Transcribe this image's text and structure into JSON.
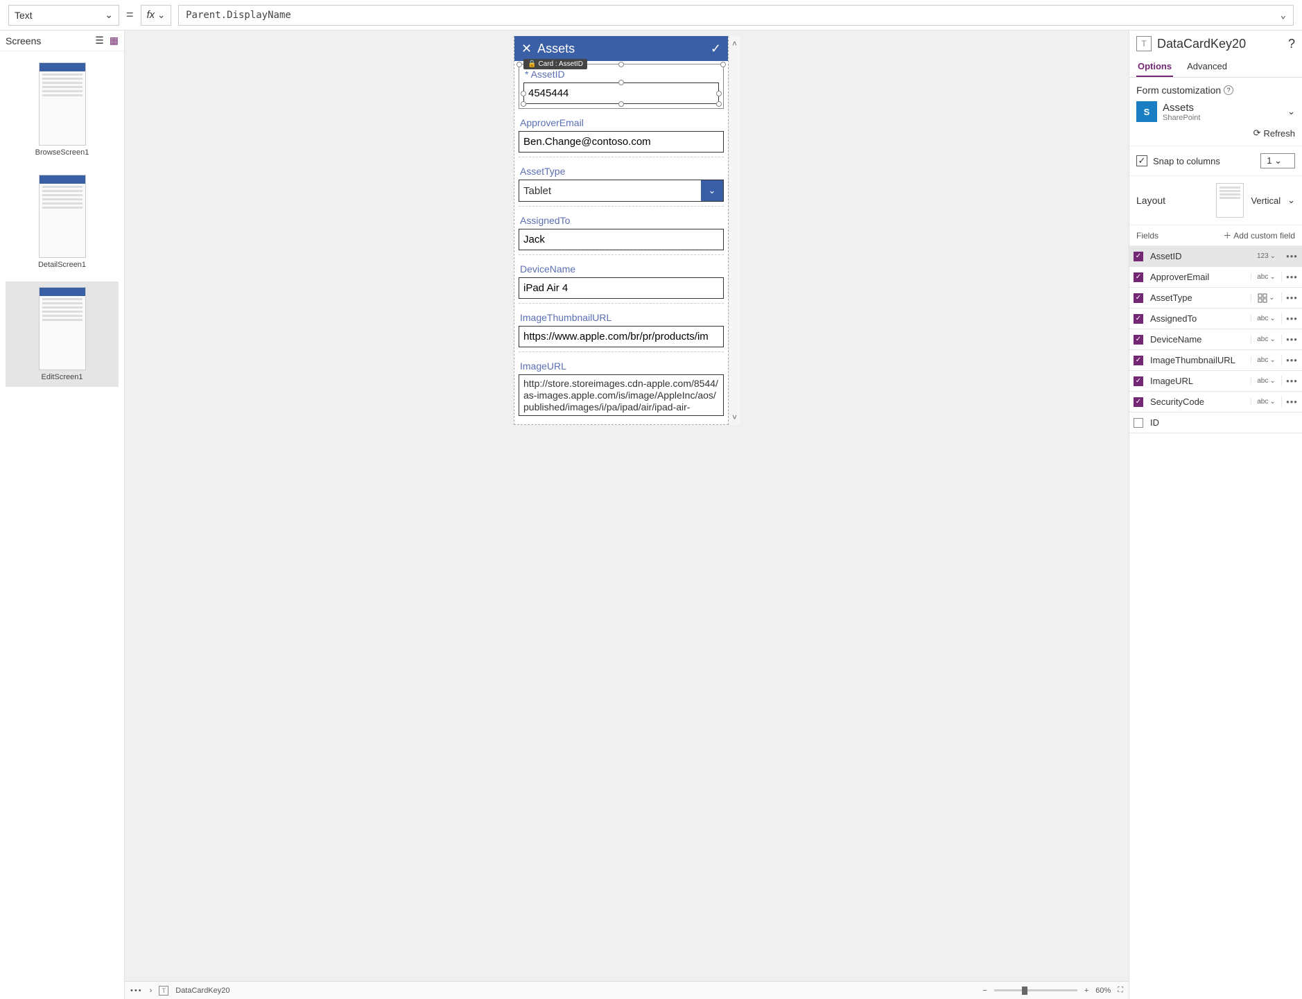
{
  "formulaBar": {
    "property": "Text",
    "fxLabel": "fx",
    "formula": "Parent.DisplayName"
  },
  "leftPane": {
    "title": "Screens"
  },
  "screens": [
    {
      "name": "BrowseScreen1"
    },
    {
      "name": "DetailScreen1"
    },
    {
      "name": "EditScreen1",
      "selected": true
    }
  ],
  "selectedCardTooltip": "Card : AssetID",
  "phone": {
    "title": "Assets",
    "cards": {
      "assetId": {
        "label": "* AssetID",
        "value": "4545444"
      },
      "approverEmail": {
        "label": "ApproverEmail",
        "value": "Ben.Change@contoso.com"
      },
      "assetType": {
        "label": "AssetType",
        "value": "Tablet"
      },
      "assignedTo": {
        "label": "AssignedTo",
        "value": "Jack"
      },
      "deviceName": {
        "label": "DeviceName",
        "value": "iPad Air 4"
      },
      "imgThumb": {
        "label": "ImageThumbnailURL",
        "value": "https://www.apple.com/br/pr/products/im"
      },
      "imgUrl": {
        "label": "ImageURL",
        "value": "http://store.storeimages.cdn-apple.com/8544/as-images.apple.com/is/image/AppleInc/aos/published/images/i/pa/ipad/air/ipad-air-"
      }
    }
  },
  "breadcrumb": {
    "element": "DataCardKey20",
    "zoom": "60%"
  },
  "rightPane": {
    "title": "DataCardKey20",
    "tabs": {
      "options": "Options",
      "advanced": "Advanced"
    },
    "formCustomization": "Form customization",
    "dataSource": {
      "name": "Assets",
      "provider": "SharePoint"
    },
    "refresh": "Refresh",
    "snap": {
      "label": "Snap to columns",
      "value": "1"
    },
    "layout": {
      "label": "Layout",
      "value": "Vertical"
    },
    "fieldsHeader": "Fields",
    "addCustom": "Add custom field"
  },
  "fields": [
    {
      "name": "AssetID",
      "checked": true,
      "type": "123"
    },
    {
      "name": "ApproverEmail",
      "checked": true,
      "type": "abc"
    },
    {
      "name": "AssetType",
      "checked": true,
      "type": "grid"
    },
    {
      "name": "AssignedTo",
      "checked": true,
      "type": "abc"
    },
    {
      "name": "DeviceName",
      "checked": true,
      "type": "abc"
    },
    {
      "name": "ImageThumbnailURL",
      "checked": true,
      "type": "abc"
    },
    {
      "name": "ImageURL",
      "checked": true,
      "type": "abc"
    },
    {
      "name": "SecurityCode",
      "checked": true,
      "type": "abc"
    },
    {
      "name": "ID",
      "checked": false,
      "type": ""
    }
  ]
}
